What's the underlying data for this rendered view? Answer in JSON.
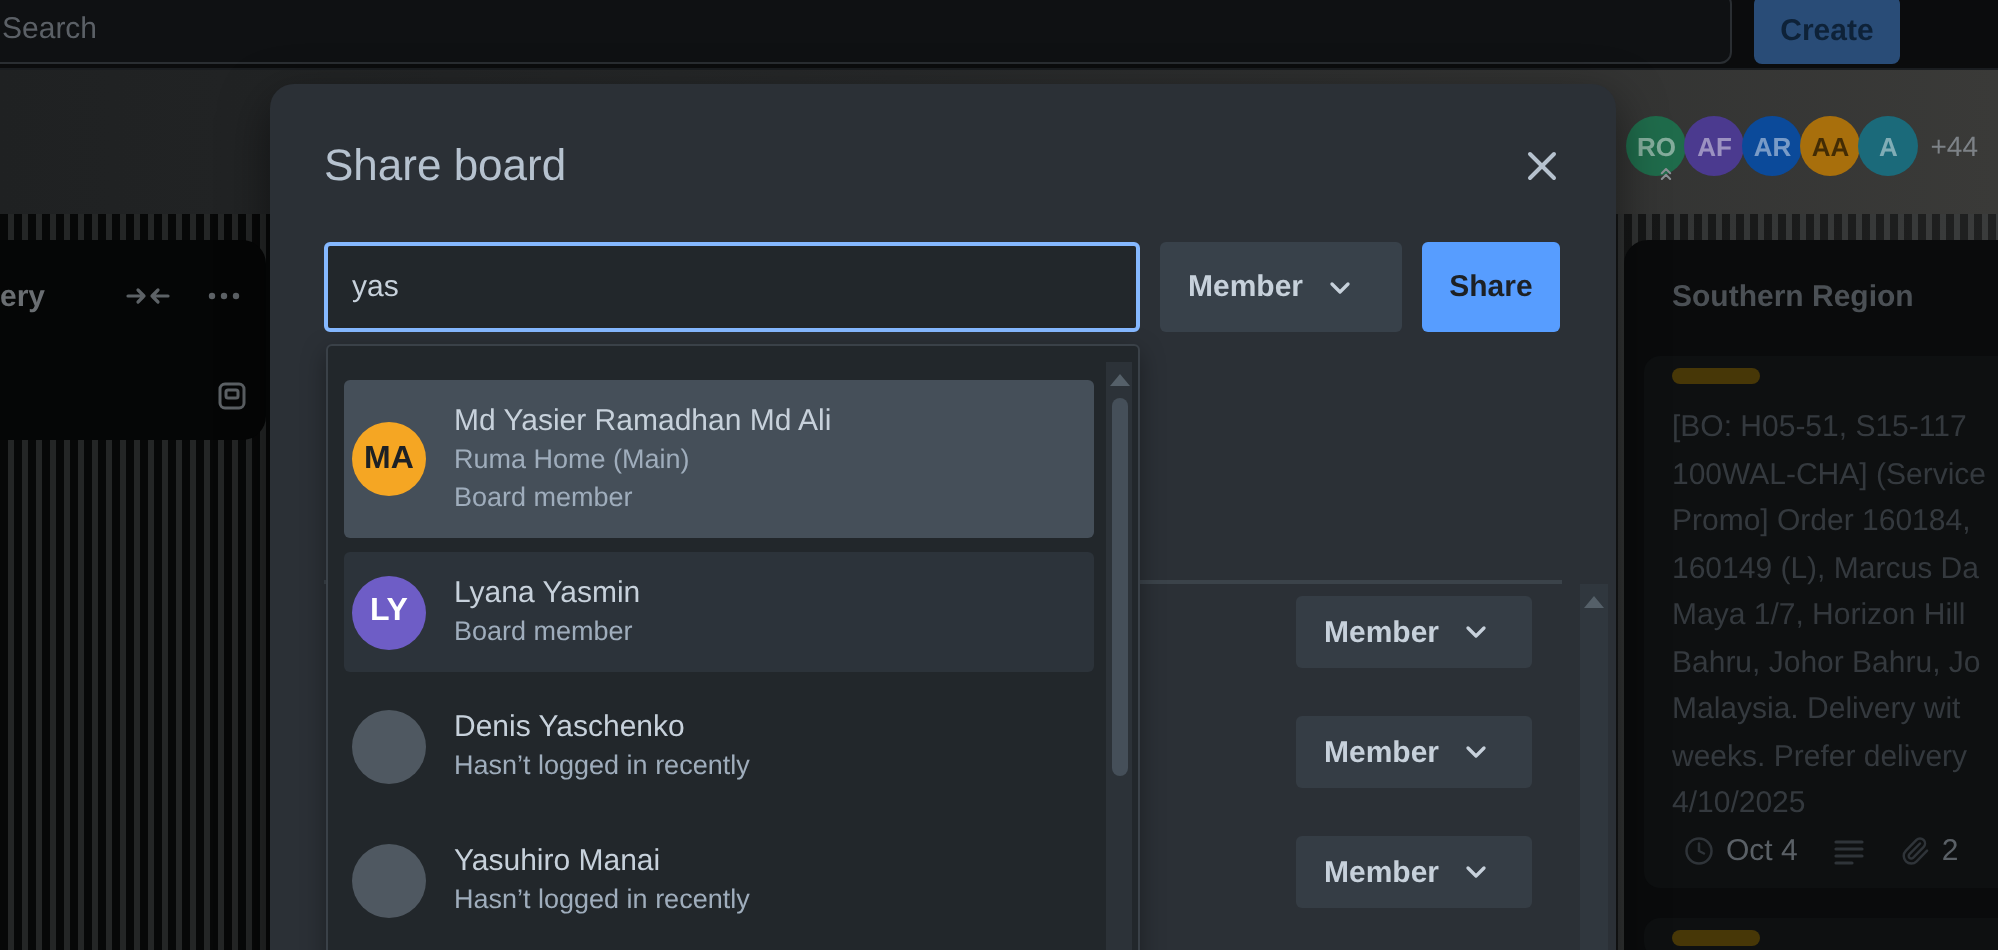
{
  "top_bar": {
    "search_placeholder": "Search",
    "create_button": "Create"
  },
  "board_header": {
    "members": [
      {
        "initials": "RO",
        "color": "#1f6b4b",
        "admin": true
      },
      {
        "initials": "AF",
        "color": "#4b3a8f",
        "admin": false
      },
      {
        "initials": "AR",
        "color": "#0b4a9a",
        "admin": false
      },
      {
        "initials": "AA",
        "color": "#a86f0c",
        "admin": false
      },
      {
        "initials": "A",
        "color": "#1b6a7a",
        "admin": false
      }
    ],
    "more_count": "+44"
  },
  "left_list": {
    "title": "ery"
  },
  "right_list": {
    "title": "Southern Region",
    "cards": [
      {
        "color": "#473707",
        "description_lines": [
          "[BO: H05-51, S15-117",
          "100WAL-CHA] (Service",
          "Promo] Order 160184,",
          "160149 (L), Marcus Da",
          "Maya 1/7, Horizon Hill",
          "Bahru, Johor Bahru, Jo",
          "Malaysia. Delivery wit",
          "weeks. Prefer delivery",
          "4/10/2025"
        ],
        "due": "Oct 4",
        "has_description": true,
        "attachments": "2"
      },
      {
        "color": "#473707"
      }
    ]
  },
  "dialog": {
    "title": "Share board",
    "search_value": "yas",
    "role_select": "Member",
    "share_button": "Share",
    "suggestions": [
      {
        "initials": "MA",
        "color": "#f5a623",
        "name": "Md Yasier Ramadhan Md Ali",
        "details": [
          "Ruma Home (Main)",
          "Board member"
        ],
        "selected": true,
        "disabled": true
      },
      {
        "initials": "LY",
        "color": "#6e5dc6",
        "name": "Lyana Yasmin",
        "details": [
          "Board member"
        ],
        "selected": false,
        "disabled": true
      },
      {
        "color": "#4f5861",
        "name": "Denis Yaschenko",
        "details": [
          "Hasn’t logged in recently"
        ],
        "selected": false,
        "disabled": false
      },
      {
        "color": "#4f5861",
        "name": "Yasuhiro Manai",
        "details": [
          "Hasn’t logged in recently"
        ],
        "selected": false,
        "disabled": false
      }
    ],
    "members": [
      {
        "role": "Member"
      },
      {
        "role": "Member"
      },
      {
        "role": "Member"
      }
    ]
  }
}
